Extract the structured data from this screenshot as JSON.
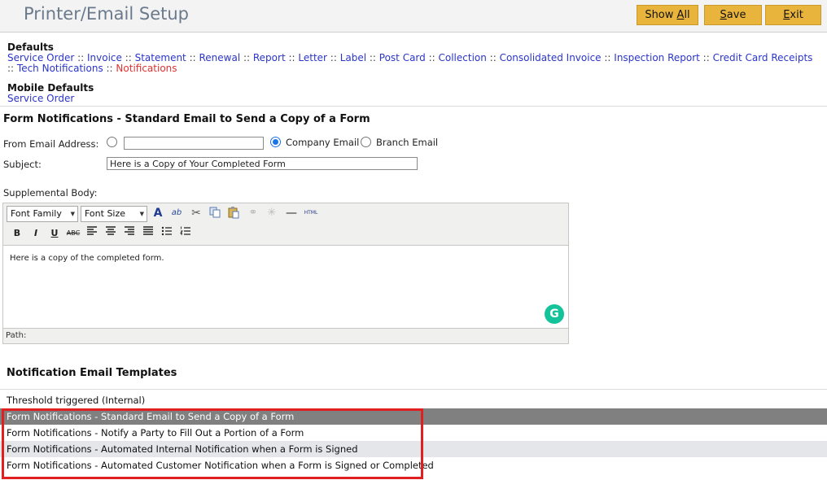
{
  "header": {
    "title": "Printer/Email Setup",
    "buttons": {
      "show_all": "Show All",
      "save": "Save",
      "exit": "Exit"
    }
  },
  "defaults": {
    "label": "Defaults",
    "links": [
      "Service Order",
      "Invoice",
      "Statement",
      "Renewal",
      "Report",
      "Letter",
      "Label",
      "Post Card",
      "Collection",
      "Consolidated Invoice",
      "Inspection Report",
      "Credit Card Receipts",
      "Tech Notifications",
      "Notifications"
    ],
    "active": "Notifications",
    "separator": "::"
  },
  "mobile_defaults": {
    "label": "Mobile Defaults",
    "link": "Service Order"
  },
  "form": {
    "title": "Form Notifications - Standard Email to Send a Copy of a Form",
    "from_label": "From Email Address:",
    "from_custom_value": "",
    "from_options": {
      "company": "Company Email",
      "branch": "Branch Email"
    },
    "from_selected": "company",
    "subject_label": "Subject:",
    "subject_value": "Here is a Copy of Your Completed Form",
    "body_label": "Supplemental Body:"
  },
  "editor": {
    "font_family": "Font Family",
    "font_size": "Font Size",
    "content": "Here is a copy of the completed form.",
    "path_label": "Path:",
    "toolbar_icons": [
      "font-color-icon",
      "highlight-color-icon",
      "cut-icon",
      "copy-icon",
      "paste-icon",
      "link-icon",
      "unlink-icon",
      "horizontal-rule-icon",
      "html-source-icon",
      "bold-icon",
      "italic-icon",
      "underline-icon",
      "strikethrough-icon",
      "align-left-icon",
      "align-center-icon",
      "align-right-icon",
      "justify-icon",
      "bullet-list-icon",
      "numbered-list-icon"
    ],
    "html_label": "HTML"
  },
  "templates": {
    "title": "Notification Email Templates",
    "items": [
      "Threshold triggered (Internal)",
      "Form Notifications - Standard Email to Send a Copy of a Form",
      "Form Notifications - Notify a Party to Fill Out a Portion of a Form",
      "Form Notifications - Automated Internal Notification when a Form is Signed",
      "Form Notifications - Automated Customer Notification when a Form is Signed or Completed"
    ],
    "selected_index": 1
  },
  "colors": {
    "button": "#e9b43c",
    "link": "#2b35c8",
    "active_link": "#e03232",
    "selected_row": "#808080",
    "highlight_box": "#e02020",
    "radio": "#1a73e8"
  }
}
